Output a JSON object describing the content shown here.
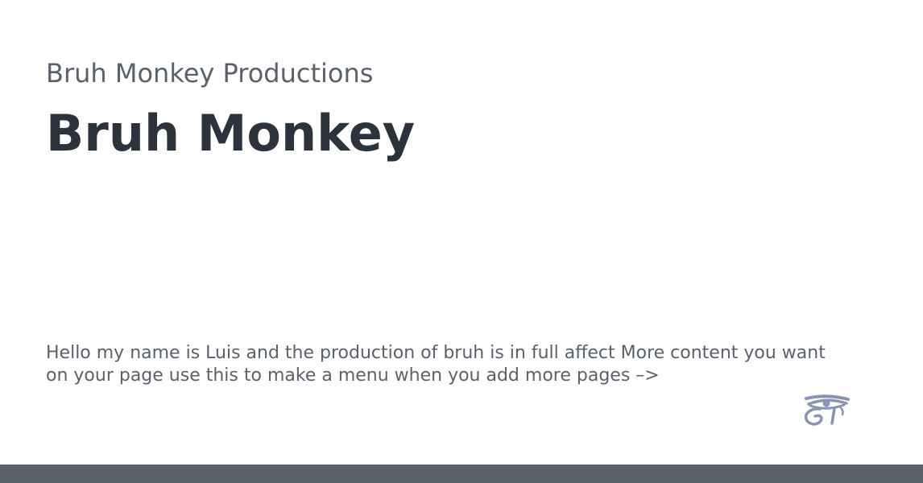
{
  "header": {
    "site_name": "Bruh Monkey Productions",
    "title": "Bruh Monkey"
  },
  "main": {
    "intro_text": "Hello my name is Luis and the production of bruh is in full affect More content you want on your page use this to make a menu when you add more pages –>"
  },
  "menu": {
    "icon": "eye-of-horus-icon"
  },
  "colors": {
    "background": "#ffffff",
    "text_muted": "#5b616b",
    "text_dark": "#2c333c",
    "icon": "#8a93b0",
    "footer": "#5b616b"
  }
}
